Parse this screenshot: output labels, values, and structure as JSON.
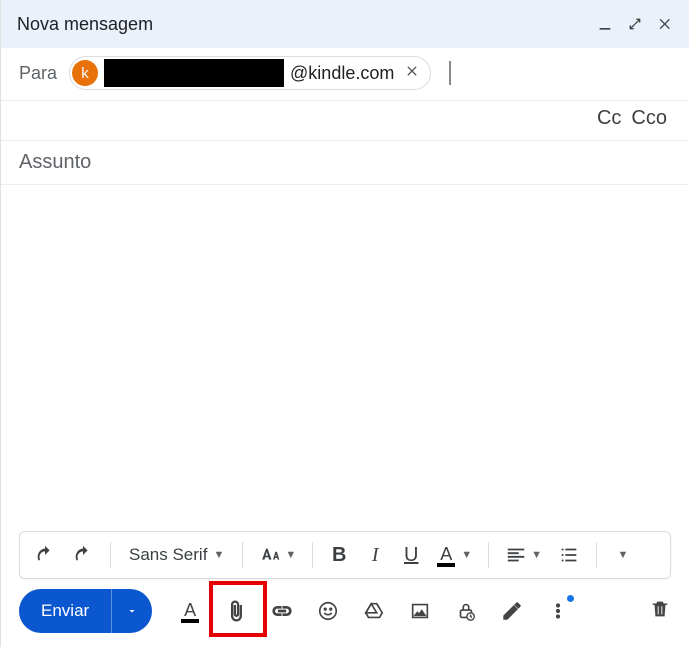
{
  "header": {
    "title": "Nova mensagem"
  },
  "to": {
    "label": "Para",
    "chip": {
      "avatar_letter": "k",
      "domain": "@kindle.com"
    }
  },
  "cc": {
    "cc_label": "Cc",
    "bcc_label": "Cco"
  },
  "subject": {
    "placeholder": "Assunto"
  },
  "format": {
    "font_name": "Sans Serif",
    "bold": "B",
    "italic": "I",
    "underline": "U",
    "color_letter": "A"
  },
  "actions": {
    "send": "Enviar"
  }
}
